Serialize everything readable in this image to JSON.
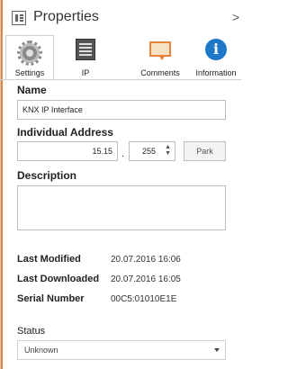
{
  "header": {
    "title": "Properties",
    "close_glyph": ">",
    "icon": "properties-icon"
  },
  "tabs": [
    {
      "label": "Settings",
      "icon": "gear-icon",
      "active": true
    },
    {
      "label": "IP",
      "icon": "document-icon",
      "active": false
    },
    {
      "label": "Comments",
      "icon": "comment-icon",
      "active": false
    },
    {
      "label": "Information",
      "icon": "info-icon",
      "active": false
    }
  ],
  "form": {
    "name_label": "Name",
    "name_value": "KNX IP Interface",
    "address_label": "Individual Address",
    "address_area_line": "15.15",
    "address_separator": ".",
    "address_device": "255",
    "park_label": "Park",
    "description_label": "Description",
    "description_value": ""
  },
  "info": {
    "last_modified_label": "Last Modified",
    "last_modified_value": "20.07.2016 16:06",
    "last_downloaded_label": "Last Downloaded",
    "last_downloaded_value": "20.07.2016 16:05",
    "serial_label": "Serial Number",
    "serial_value": "00C5:01010E1E"
  },
  "status": {
    "label": "Status",
    "value": "Unknown"
  },
  "colors": {
    "accent": "#e8833a",
    "info_blue": "#1e78c8"
  }
}
